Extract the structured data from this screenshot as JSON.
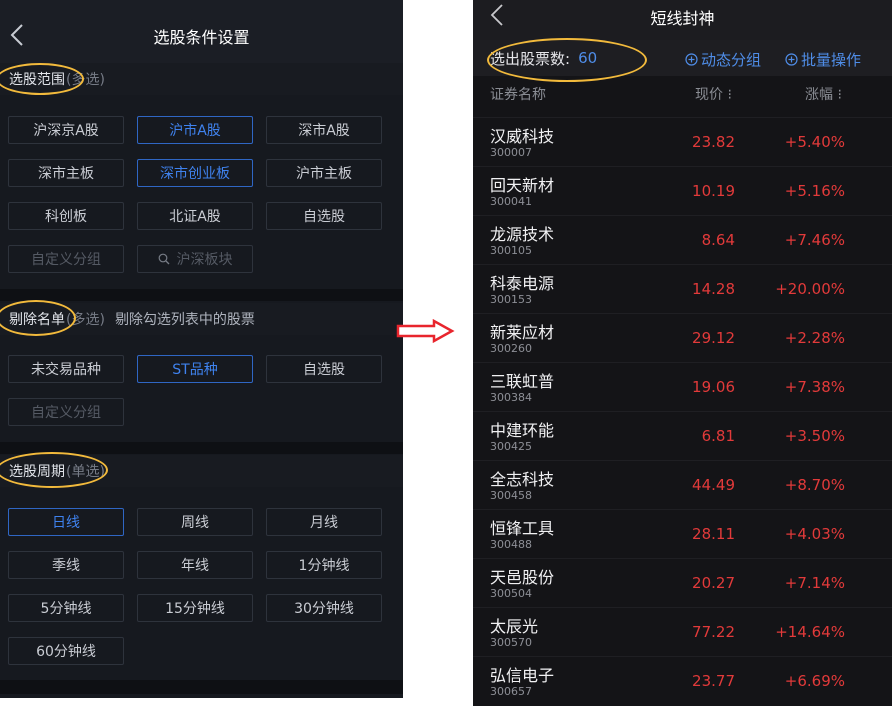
{
  "left": {
    "title": "选股条件设置",
    "scope": {
      "title": "选股范围",
      "hint": "(多选)",
      "options": [
        {
          "label": "沪深京A股",
          "state": "normal"
        },
        {
          "label": "沪市A股",
          "state": "selected"
        },
        {
          "label": "深市A股",
          "state": "normal"
        },
        {
          "label": "深市主板",
          "state": "normal"
        },
        {
          "label": "深市创业板",
          "state": "selected"
        },
        {
          "label": "沪市主板",
          "state": "normal"
        },
        {
          "label": "科创板",
          "state": "normal"
        },
        {
          "label": "北证A股",
          "state": "normal"
        },
        {
          "label": "自选股",
          "state": "normal"
        },
        {
          "label": "自定义分组",
          "state": "disabled"
        },
        {
          "label": "沪深板块",
          "state": "disabled",
          "icon": "search-icon"
        }
      ]
    },
    "exclude": {
      "title": "剔除名单",
      "hint": "(多选)",
      "note": "剔除勾选列表中的股票",
      "options": [
        {
          "label": "未交易品种",
          "state": "normal"
        },
        {
          "label": "ST品种",
          "state": "selected"
        },
        {
          "label": "自选股",
          "state": "normal"
        },
        {
          "label": "自定义分组",
          "state": "disabled"
        }
      ]
    },
    "period": {
      "title": "选股周期",
      "hint": "(单选)",
      "options": [
        {
          "label": "日线",
          "state": "selected"
        },
        {
          "label": "周线",
          "state": "normal"
        },
        {
          "label": "月线",
          "state": "normal"
        },
        {
          "label": "季线",
          "state": "normal"
        },
        {
          "label": "年线",
          "state": "normal"
        },
        {
          "label": "1分钟线",
          "state": "normal"
        },
        {
          "label": "5分钟线",
          "state": "normal"
        },
        {
          "label": "15分钟线",
          "state": "normal"
        },
        {
          "label": "30分钟线",
          "state": "normal"
        },
        {
          "label": "60分钟线",
          "state": "normal"
        }
      ]
    }
  },
  "right": {
    "title": "短线封神",
    "count_label": "选出股票数:",
    "count_value": "60",
    "actions": [
      "动态分组",
      "批量操作"
    ],
    "columns": [
      "证券名称",
      "现价 ⁝",
      "涨幅 ⁝"
    ],
    "rows": [
      {
        "name": "汉威科技",
        "code": "300007",
        "price": "23.82",
        "change": "+5.40%"
      },
      {
        "name": "回天新材",
        "code": "300041",
        "price": "10.19",
        "change": "+5.16%"
      },
      {
        "name": "龙源技术",
        "code": "300105",
        "price": "8.64",
        "change": "+7.46%"
      },
      {
        "name": "科泰电源",
        "code": "300153",
        "price": "14.28",
        "change": "+20.00%"
      },
      {
        "name": "新莱应材",
        "code": "300260",
        "price": "29.12",
        "change": "+2.28%"
      },
      {
        "name": "三联虹普",
        "code": "300384",
        "price": "19.06",
        "change": "+7.38%"
      },
      {
        "name": "中建环能",
        "code": "300425",
        "price": "6.81",
        "change": "+3.50%"
      },
      {
        "name": "全志科技",
        "code": "300458",
        "price": "44.49",
        "change": "+8.70%"
      },
      {
        "name": "恒锋工具",
        "code": "300488",
        "price": "28.11",
        "change": "+4.03%"
      },
      {
        "name": "天邑股份",
        "code": "300504",
        "price": "20.27",
        "change": "+7.14%"
      },
      {
        "name": "太辰光",
        "code": "300570",
        "price": "77.22",
        "change": "+14.64%"
      },
      {
        "name": "弘信电子",
        "code": "300657",
        "price": "23.77",
        "change": "+6.69%"
      }
    ]
  },
  "colors": {
    "accent_blue": "#3f82ee",
    "highlight_oval": "#f2ba3c",
    "price_red": "#e23a3a",
    "arrow_red": "#e8252d"
  }
}
